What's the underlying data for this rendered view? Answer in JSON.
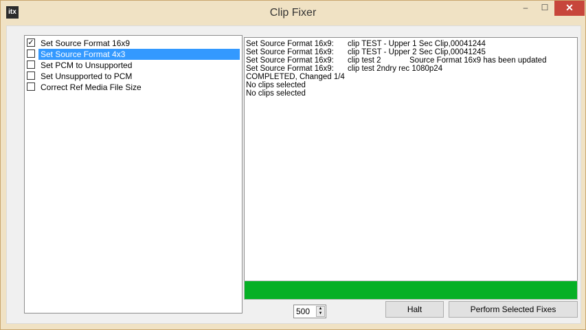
{
  "window": {
    "title": "Clip Fixer",
    "app_icon_text": "itx",
    "controls": {
      "minimize": "–",
      "maximize": "☐",
      "close": "✕"
    }
  },
  "fixes": [
    {
      "label": "Set Source Format 16x9",
      "checked": true,
      "selected": false
    },
    {
      "label": "Set Source Format 4x3",
      "checked": false,
      "selected": true
    },
    {
      "label": "Set PCM to Unsupported",
      "checked": false,
      "selected": false
    },
    {
      "label": "Set Unsupported to PCM",
      "checked": false,
      "selected": false
    },
    {
      "label": "Correct Ref Media File Size",
      "checked": false,
      "selected": false
    }
  ],
  "log": [
    {
      "prefix": "Set Source Format 16x9:",
      "clip": "clip TEST - Upper 1 Sec Clip,00041244",
      "message": ""
    },
    {
      "prefix": "Set Source Format 16x9:",
      "clip": "clip TEST - Upper 2 Sec Clip,00041245",
      "message": ""
    },
    {
      "prefix": "Set Source Format 16x9:",
      "clip": "clip test 2",
      "message": "Source Format 16x9 has been updated"
    },
    {
      "prefix": "Set Source Format 16x9:",
      "clip": "clip test 2ndry rec 1080p24",
      "message": ""
    },
    {
      "prefix": "COMPLETED, Changed 1/4",
      "clip": "",
      "message": ""
    },
    {
      "prefix": "No clips selected",
      "clip": "",
      "message": ""
    },
    {
      "prefix": "No clips selected",
      "clip": "",
      "message": ""
    }
  ],
  "progress": {
    "value_percent": 100,
    "color": "#06b025"
  },
  "batch_size": {
    "value": "500"
  },
  "buttons": {
    "halt": "Halt",
    "perform": "Perform Selected Fixes"
  },
  "colors": {
    "selection": "#3399ff",
    "frame": "#f0e2c4",
    "close": "#c7463b"
  }
}
